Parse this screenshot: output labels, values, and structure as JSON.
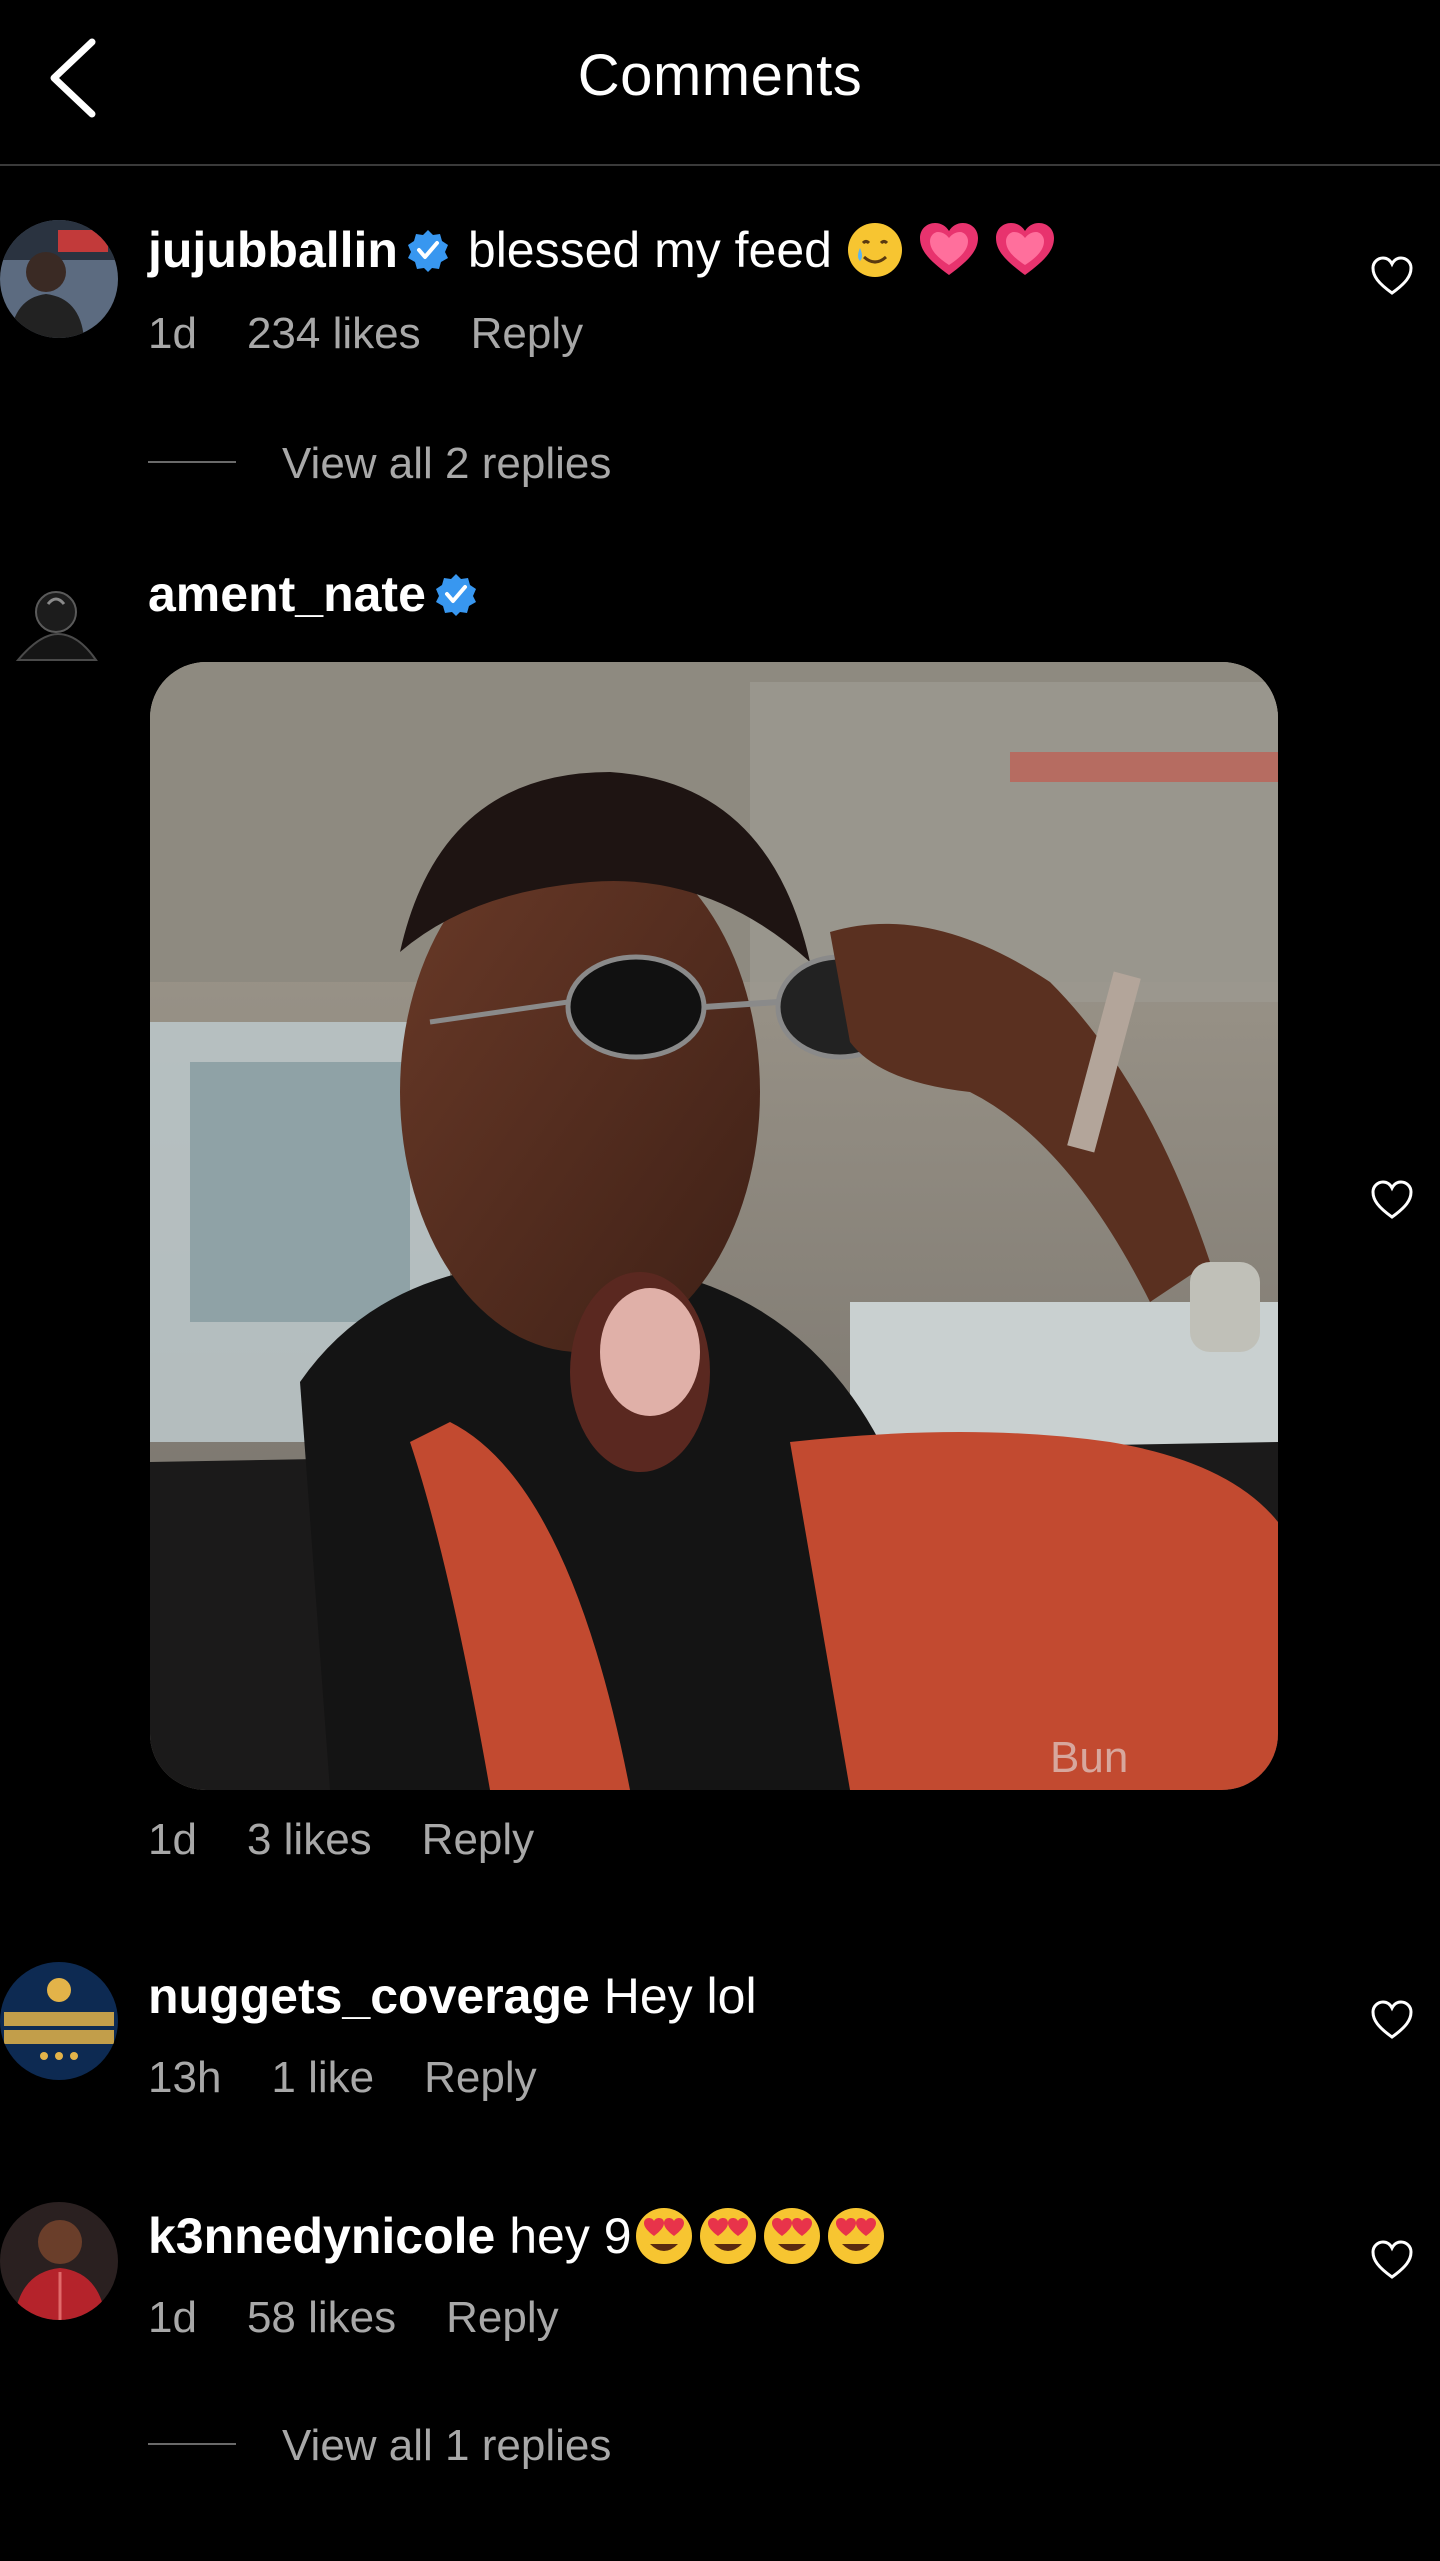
{
  "header": {
    "title": "Comments",
    "back_icon": "chevron-left-icon"
  },
  "colors": {
    "background": "#000000",
    "text": "#ffffff",
    "meta_text": "#a8a8a8",
    "verified_badge": "#3897f0",
    "divider": "#3a3a3a"
  },
  "comments": [
    {
      "username": "jujubballin",
      "verified": true,
      "text": "blessed my feed",
      "emojis": [
        "smiling-face-with-tear",
        "growing-heart",
        "growing-heart"
      ],
      "time": "1d",
      "likes": "234 likes",
      "reply_label": "Reply",
      "view_replies": "View all 2 replies"
    },
    {
      "username": "ament_nate",
      "verified": true,
      "text": "",
      "attachment": "gif-image",
      "time": "1d",
      "likes": "3 likes",
      "reply_label": "Reply"
    },
    {
      "username": "nuggets_coverage",
      "verified": false,
      "text": "Hey lol",
      "time": "13h",
      "likes": "1 like",
      "reply_label": "Reply"
    },
    {
      "username": "k3nnedynicole",
      "verified": false,
      "text": "hey 9",
      "emojis": [
        "heart-eyes",
        "heart-eyes",
        "heart-eyes",
        "heart-eyes"
      ],
      "time": "1d",
      "likes": "58 likes",
      "reply_label": "Reply",
      "view_replies": "View all 1 replies"
    }
  ],
  "icons": {
    "like": "heart-outline-icon",
    "verified": "verified-badge-icon"
  }
}
